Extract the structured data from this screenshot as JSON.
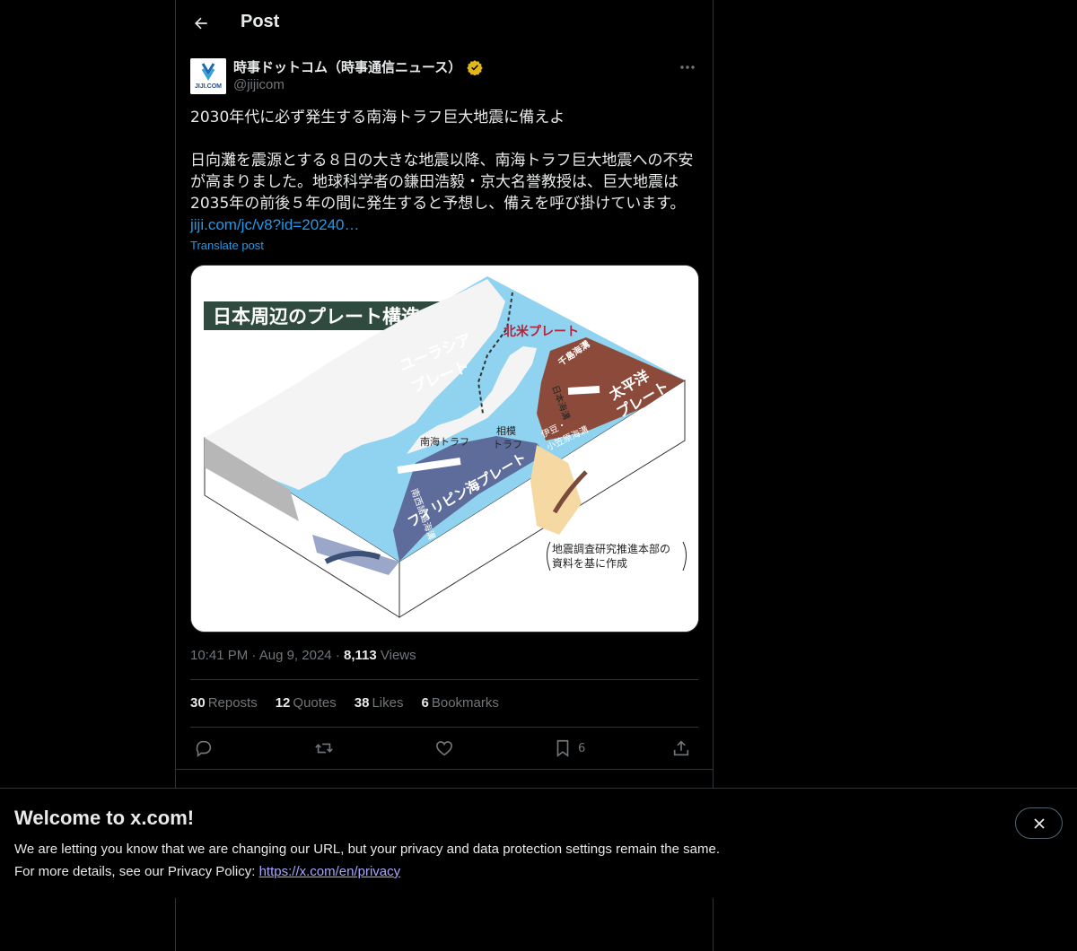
{
  "header": {
    "title": "Post",
    "back_icon": "arrow-left-icon"
  },
  "author": {
    "name": "時事ドットコム（時事通信ニュース）",
    "handle": "@jijicom",
    "avatar_text": "JIJI.COM",
    "verified_color": "#e2b719"
  },
  "post": {
    "line1": "2030年代に必ず発生する南海トラフ巨大地震に備えよ",
    "para2_line1": "日向灘を震源とする８日の大きな地震以降、南海トラフ巨大地震への不安",
    "para2_line2": "が高まりました。地球科学者の鎌田浩毅・京大名誉教授は、巨大地震は",
    "para2_line3": "2035年の前後５年の間に発生すると予想し、備えを呼び掛けています。",
    "link": "jiji.com/jc/v8?id=20240…",
    "translate": "Translate post"
  },
  "media": {
    "title": "日本周辺のプレート構造",
    "labels": {
      "eurasia": "ユーラシア",
      "eurasia2": "プレート",
      "north_america": "北米プレート",
      "pacific": "太平洋",
      "pacific2": "プレート",
      "philippine": "フィリピン海プレート",
      "nankai": "南海トラフ",
      "sagami": "相模",
      "sagami2": "トラフ",
      "chishima": "千島海溝",
      "japan_trench": "日本海溝",
      "izu": "伊豆・",
      "izu2": "小笠原海溝",
      "nansei": "南西諸島海溝",
      "source": "地震調査研究推進本部の",
      "source2": "資料を基に作成"
    }
  },
  "meta": {
    "time": "10:41 PM",
    "date": "Aug 9, 2024",
    "views": "8,113",
    "views_label": "Views"
  },
  "stats": {
    "reposts": "30",
    "reposts_label": "Reposts",
    "quotes": "12",
    "quotes_label": "Quotes",
    "likes": "38",
    "likes_label": "Likes",
    "bookmarks": "6",
    "bookmarks_label": "Bookmarks"
  },
  "actions": {
    "bookmark_count": "6"
  },
  "banner": {
    "title": "Welcome to x.com!",
    "line1": "We are letting you know that we are changing our URL, but your privacy and data protection settings remain the same.",
    "line2_prefix": "For more details, see our Privacy Policy: ",
    "link": "https://x.com/en/privacy"
  }
}
